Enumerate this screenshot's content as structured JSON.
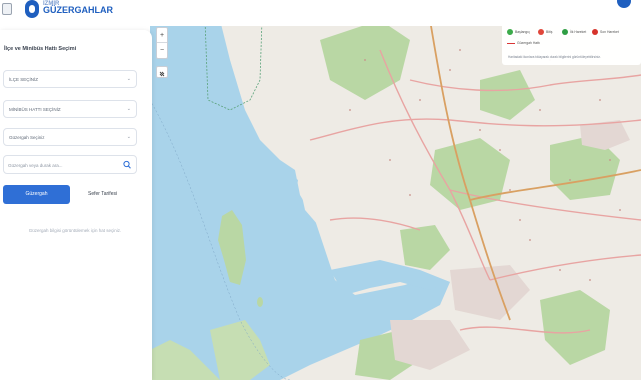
{
  "header": {
    "brand_small": "İZMİR",
    "brand_title": "GÜZERGAHLAR"
  },
  "panel": {
    "title": "İlçe ve Minibüs Hattı Seçimi",
    "district_select": {
      "value": "İLÇE SEÇİNİZ"
    },
    "line_select": {
      "value": "MİNİBÜS HATTI SEÇİNİZ"
    },
    "route_select": {
      "value": "Güzergah Seçiniz"
    },
    "search": {
      "placeholder": "Güzergah veya durak ara..."
    },
    "primary_button": "Güzergah",
    "secondary_button": "Sefer Tarifesi",
    "hint": "Güzergah bilgisi görüntülemek için hat seçiniz."
  },
  "map_controls": {
    "zoom_in": "+",
    "zoom_out": "−"
  },
  "legend": {
    "items": [
      {
        "label": "Başlangıç",
        "color": "#3cab4a"
      },
      {
        "label": "Bitiş",
        "color": "#e0463a"
      },
      {
        "label": "İlk Hareket",
        "color": "#2f9e44"
      },
      {
        "label": "Son Hareket",
        "color": "#d6332b"
      }
    ],
    "route_line_label": "Güzergah Hattı",
    "note": "Haritadaki ikonlara tıklayarak durak bilgilerini görüntüleyebilirsiniz."
  },
  "colors": {
    "accent": "#2f6fd6",
    "sea": "#a9d3ea",
    "land": "#efece6",
    "forest": "#b9d7a4",
    "road": "#e8a4a2",
    "highway": "#d9a062"
  }
}
